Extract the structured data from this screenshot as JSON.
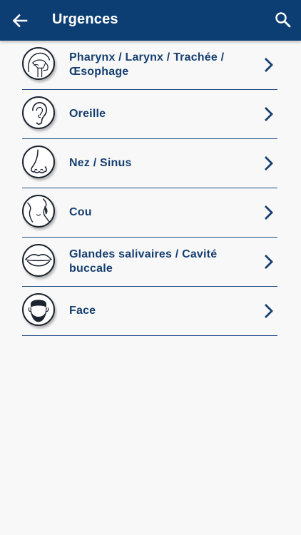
{
  "appbar": {
    "title": "Urgences",
    "back_icon": "arrow-left-icon",
    "search_icon": "search-icon",
    "background": "#0c3e73"
  },
  "list": {
    "items": [
      {
        "label": "Pharynx / Larynx / Trachée / Œsophage",
        "icon": "throat-anatomy-icon"
      },
      {
        "label": "Oreille",
        "icon": "ear-icon"
      },
      {
        "label": "Nez / Sinus",
        "icon": "nose-icon"
      },
      {
        "label": "Cou",
        "icon": "neck-icon"
      },
      {
        "label": "Glandes salivaires / Cavité buccale",
        "icon": "mouth-icon"
      },
      {
        "label": "Face",
        "icon": "face-icon"
      }
    ],
    "text_color": "#163f70",
    "divider_color": "#1f4d86"
  }
}
